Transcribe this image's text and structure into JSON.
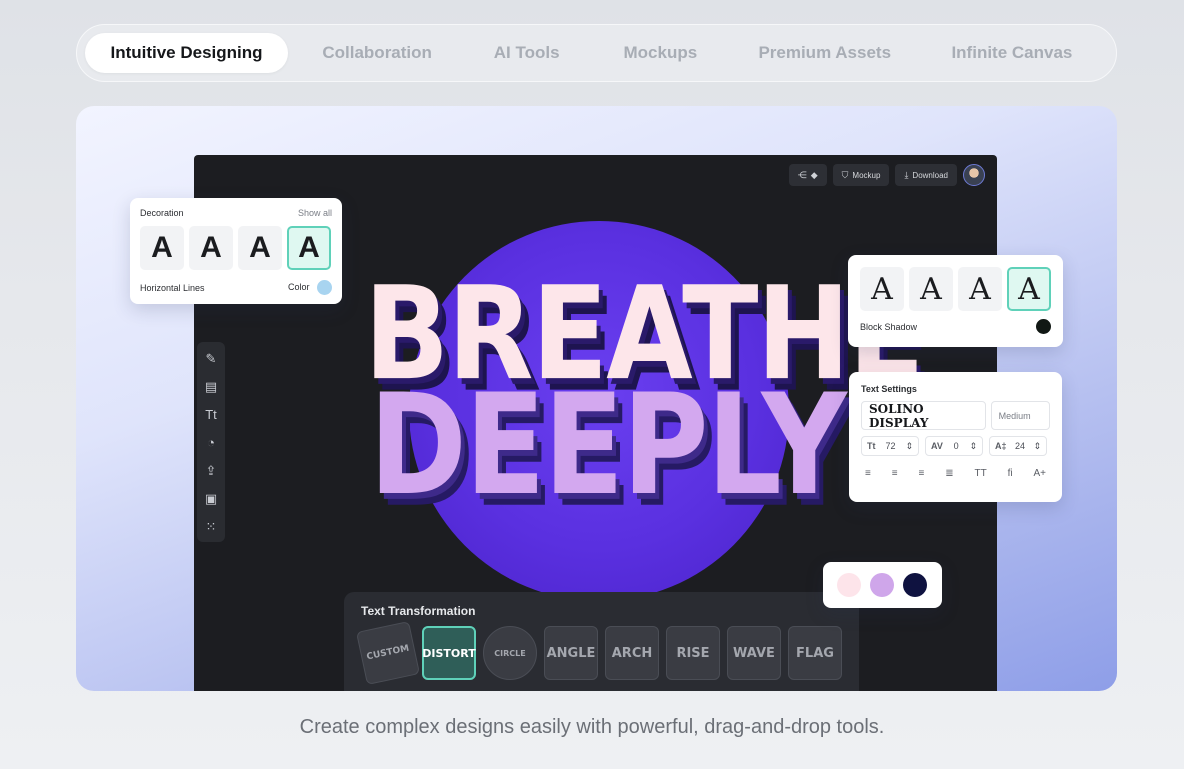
{
  "tabs": [
    {
      "label": "Intuitive Designing",
      "active": true
    },
    {
      "label": "Collaboration"
    },
    {
      "label": "AI Tools"
    },
    {
      "label": "Mockups"
    },
    {
      "label": "Premium Assets"
    },
    {
      "label": "Infinite Canvas"
    }
  ],
  "topbar": {
    "mockup": "Mockup",
    "download": "Download"
  },
  "artwork": {
    "line1": "BREATHE",
    "line2": "DEEPLY"
  },
  "decoration": {
    "title": "Decoration",
    "show_all": "Show all",
    "glyph": "A",
    "style": "Horizontal Lines",
    "color_label": "Color",
    "color": "#a8d4f0"
  },
  "block_shadow": {
    "glyph": "A",
    "label": "Block Shadow",
    "color": "#111814"
  },
  "text_settings": {
    "title": "Text Settings",
    "font": "SOLINO DISPLAY",
    "weight": "Medium",
    "size": "72",
    "tracking": "0",
    "leading": "24",
    "size_label": "Tt",
    "tracking_label": "AV",
    "leading_label": "A‡",
    "case": "TT",
    "ligature": "fi",
    "more": "A+"
  },
  "palette": {
    "colors": [
      "#fde4ea",
      "#cfa6ea",
      "#0f1240"
    ]
  },
  "transformation": {
    "title": "Text Transformation",
    "options": [
      "CUSTOM",
      "DISTORT",
      "CIRCLE",
      "ANGLE",
      "ARCH",
      "RISE",
      "WAVE",
      "FLAG"
    ]
  },
  "caption": "Create complex designs easily with powerful, drag-and-drop tools."
}
